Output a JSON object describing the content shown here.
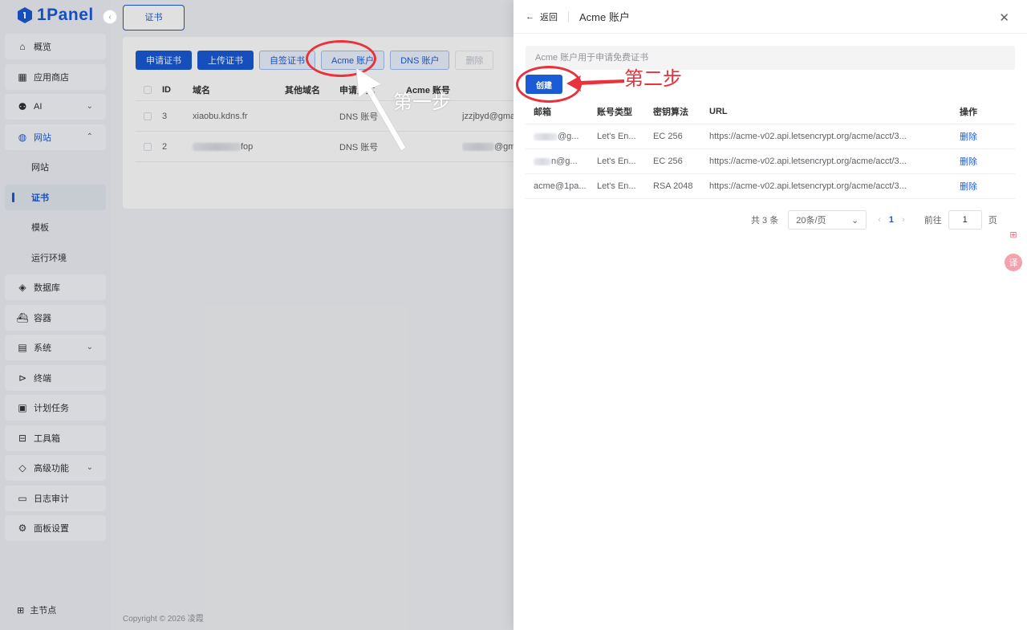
{
  "brand": {
    "name": "1Panel"
  },
  "sidebar": {
    "items": [
      {
        "label": "概览",
        "icon": "home-icon"
      },
      {
        "label": "应用商店",
        "icon": "grid-icon"
      },
      {
        "label": "AI",
        "icon": "robot-icon"
      },
      {
        "label": "网站",
        "icon": "globe-icon"
      },
      {
        "label": "网站",
        "icon": ""
      },
      {
        "label": "证书",
        "icon": ""
      },
      {
        "label": "模板",
        "icon": ""
      },
      {
        "label": "运行环境",
        "icon": ""
      },
      {
        "label": "数据库",
        "icon": "database-icon"
      },
      {
        "label": "容器",
        "icon": "container-icon"
      },
      {
        "label": "系统",
        "icon": "server-icon"
      },
      {
        "label": "终端",
        "icon": "terminal-icon"
      },
      {
        "label": "计划任务",
        "icon": "calendar-icon"
      },
      {
        "label": "工具箱",
        "icon": "toolbox-icon"
      },
      {
        "label": "高级功能",
        "icon": "diamond-icon"
      },
      {
        "label": "日志审计",
        "icon": "log-icon"
      },
      {
        "label": "面板设置",
        "icon": "gear-icon"
      }
    ],
    "bottom": "主节点"
  },
  "main": {
    "tab": "证书",
    "buttons": {
      "apply": "申请证书",
      "upload": "上传证书",
      "selfsign": "自签证书",
      "acme": "Acme 账户",
      "dns": "DNS 账户",
      "delete": "删除"
    },
    "table": {
      "headers": [
        "ID",
        "域名",
        "其他域名",
        "申请方式",
        "Acme 账号"
      ],
      "rows": [
        {
          "id": "3",
          "domain": "xiaobu.kdns.fr",
          "other": "",
          "type": "DNS 账号",
          "acme": "jzzjbyd@gmail.com"
        },
        {
          "id": "2",
          "domain": "fop",
          "other": "",
          "type": "DNS 账号",
          "acme": "@gmail.com"
        }
      ]
    },
    "footer": "Copyright © 2026 凌霞"
  },
  "annotations": {
    "step1": "第一步",
    "step2": "第二步"
  },
  "drawer": {
    "back": "返回",
    "title": "Acme 账户",
    "notice": "Acme 账户用于申请免费证书",
    "create": "创建",
    "headers": [
      "邮箱",
      "账号类型",
      "密钥算法",
      "URL",
      "操作"
    ],
    "rows": [
      {
        "email": "@g...",
        "type": "Let's En...",
        "key": "EC 256",
        "url": "https://acme-v02.api.letsencrypt.org/acme/acct/3...",
        "op": "删除"
      },
      {
        "email": "n@g...",
        "type": "Let's En...",
        "key": "EC 256",
        "url": "https://acme-v02.api.letsencrypt.org/acme/acct/3...",
        "op": "删除"
      },
      {
        "email": "acme@1pa...",
        "type": "Let's En...",
        "key": "RSA 2048",
        "url": "https://acme-v02.api.letsencrypt.org/acme/acct/3...",
        "op": "删除"
      }
    ],
    "pager": {
      "total": "共 3 条",
      "size": "20条/页",
      "current": "1",
      "goto": "前往",
      "input": "1",
      "page": "页"
    }
  }
}
